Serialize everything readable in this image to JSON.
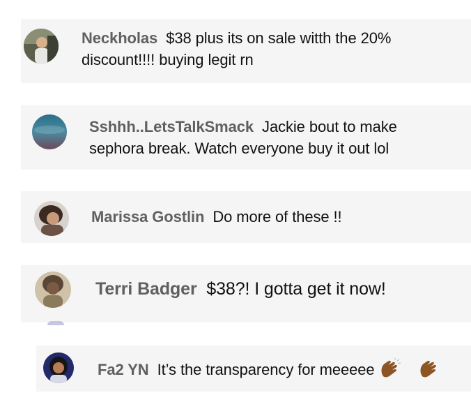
{
  "comments": [
    {
      "author": "Neckholas",
      "line1": "$38 plus its on sale witth the 20%",
      "line2": "discount!!!! buying legit rn",
      "avatar_icon": "person-photo-avatar",
      "avatar_color": "#6b6f5a"
    },
    {
      "author": "Sshhh..LetsTalkSmack",
      "line1": "Jackie bout to make",
      "line2": "sephora break. Watch everyone buy it out lol",
      "avatar_icon": "blue-gradient-avatar",
      "avatar_color": "#3f6f86"
    },
    {
      "author": "Marissa Gostlin",
      "line1": "Do more of these !!",
      "avatar_icon": "person-photo-avatar",
      "avatar_color": "#8a6a52"
    },
    {
      "author": "Terri Badger",
      "line1": "$38?! I gotta get it now!",
      "avatar_icon": "person-photo-avatar",
      "avatar_color": "#9b8a6e"
    },
    {
      "author": "Fa2 YN",
      "line1": "It’s the transparency for meeeee",
      "emoji": [
        "clapping-hands-emoji",
        "clapping-hands-emoji"
      ],
      "avatar_icon": "person-photo-avatar",
      "avatar_color": "#2a2f6a"
    }
  ],
  "colors": {
    "card_background": "#f5f5f5",
    "author_text": "#606060",
    "message_text": "#111111",
    "emoji_skin": "#8d5524"
  }
}
